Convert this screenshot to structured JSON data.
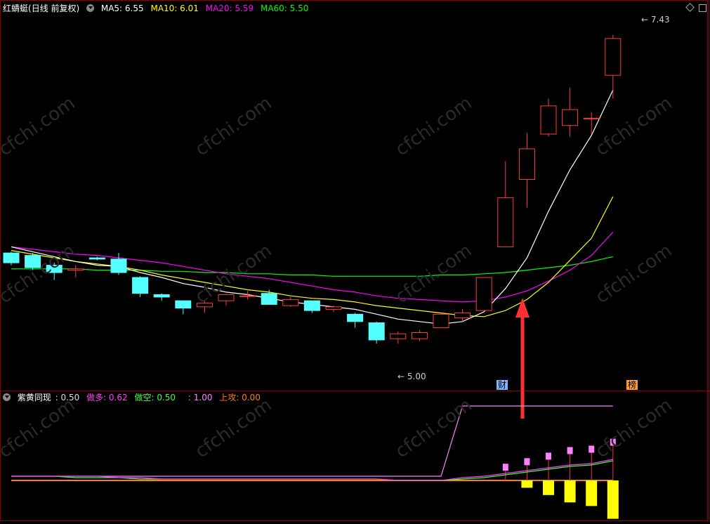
{
  "main": {
    "stock_name": "红蜻蜓",
    "period": "(日线 前复权)",
    "ma": [
      {
        "label": "MA5: 6.55",
        "color": "#ffffff"
      },
      {
        "label": "MA10: 6.01",
        "color": "#ffff00"
      },
      {
        "label": "MA20: 5.59",
        "color": "#ff00ff"
      },
      {
        "label": "MA60: 5.50",
        "color": "#00ff00"
      }
    ],
    "high_label": "7.43",
    "low_label": "5.00",
    "tag_cai": "财",
    "tag_bang": "榜"
  },
  "sub": {
    "name": "紫黄同现",
    "items": [
      {
        "label": ": 0.50",
        "color": "#dddddd"
      },
      {
        "label": "做多: 0.62",
        "color": "#ff40ff"
      },
      {
        "label": "做空: 0.50",
        "color": "#40ff40"
      },
      {
        "label": ": 1.00",
        "color": "#ff80ff"
      },
      {
        "label": "上攻: 0.00",
        "color": "#ff8000"
      }
    ]
  },
  "watermark": "cfchi.com",
  "colors": {
    "up": "#ff3c3c",
    "down": "#54ffff",
    "grid": "#8b0000"
  },
  "chart_data": {
    "type": "candlestick",
    "candles": [
      {
        "o": 6.0,
        "h": 6.01,
        "l": 5.9,
        "c": 5.92
      },
      {
        "o": 5.98,
        "h": 6.0,
        "l": 5.86,
        "c": 5.88
      },
      {
        "o": 5.9,
        "h": 5.92,
        "l": 5.78,
        "c": 5.84
      },
      {
        "o": 5.86,
        "h": 5.9,
        "l": 5.8,
        "c": 5.87
      },
      {
        "o": 5.96,
        "h": 5.97,
        "l": 5.94,
        "c": 5.95
      },
      {
        "o": 5.95,
        "h": 6.0,
        "l": 5.82,
        "c": 5.84
      },
      {
        "o": 5.8,
        "h": 5.81,
        "l": 5.64,
        "c": 5.67
      },
      {
        "o": 5.66,
        "h": 5.67,
        "l": 5.61,
        "c": 5.64
      },
      {
        "o": 5.61,
        "h": 5.61,
        "l": 5.5,
        "c": 5.55
      },
      {
        "o": 5.56,
        "h": 5.61,
        "l": 5.51,
        "c": 5.59
      },
      {
        "o": 5.61,
        "h": 5.66,
        "l": 5.57,
        "c": 5.66
      },
      {
        "o": 5.65,
        "h": 5.69,
        "l": 5.62,
        "c": 5.65
      },
      {
        "o": 5.67,
        "h": 5.7,
        "l": 5.58,
        "c": 5.58
      },
      {
        "o": 5.57,
        "h": 5.64,
        "l": 5.56,
        "c": 5.62
      },
      {
        "o": 5.61,
        "h": 5.61,
        "l": 5.51,
        "c": 5.53
      },
      {
        "o": 5.54,
        "h": 5.57,
        "l": 5.52,
        "c": 5.56
      },
      {
        "o": 5.5,
        "h": 5.51,
        "l": 5.39,
        "c": 5.44
      },
      {
        "o": 5.43,
        "h": 5.44,
        "l": 5.26,
        "c": 5.29
      },
      {
        "o": 5.3,
        "h": 5.36,
        "l": 5.26,
        "c": 5.34
      },
      {
        "o": 5.3,
        "h": 5.37,
        "l": 5.28,
        "c": 5.35
      },
      {
        "o": 5.39,
        "h": 5.51,
        "l": 5.39,
        "c": 5.5
      },
      {
        "o": 5.47,
        "h": 5.54,
        "l": 5.44,
        "c": 5.51
      },
      {
        "o": 5.53,
        "h": 5.8,
        "l": 5.53,
        "c": 5.8
      },
      {
        "o": 6.05,
        "h": 6.75,
        "l": 6.05,
        "c": 6.45
      },
      {
        "o": 6.6,
        "h": 6.98,
        "l": 6.37,
        "c": 6.85
      },
      {
        "o": 6.97,
        "h": 7.26,
        "l": 6.95,
        "c": 7.2
      },
      {
        "o": 7.04,
        "h": 7.35,
        "l": 6.95,
        "c": 7.17
      },
      {
        "o": 7.1,
        "h": 7.15,
        "l": 6.97,
        "c": 7.1
      },
      {
        "o": 7.45,
        "h": 7.78,
        "l": 7.26,
        "c": 7.75
      }
    ],
    "ma5": [
      6.05,
      6.01,
      5.97,
      5.93,
      5.9,
      5.89,
      5.84,
      5.8,
      5.75,
      5.72,
      5.68,
      5.66,
      5.63,
      5.6,
      5.58,
      5.56,
      5.54,
      5.5,
      5.46,
      5.44,
      5.42,
      5.44,
      5.52,
      5.71,
      5.96,
      6.34,
      6.68,
      6.96,
      7.33
    ],
    "ma10": [
      6.02,
      5.99,
      5.96,
      5.93,
      5.91,
      5.89,
      5.86,
      5.82,
      5.79,
      5.76,
      5.73,
      5.7,
      5.68,
      5.65,
      5.63,
      5.62,
      5.6,
      5.57,
      5.55,
      5.53,
      5.51,
      5.49,
      5.48,
      5.53,
      5.62,
      5.76,
      5.94,
      6.12,
      6.46
    ],
    "ma20": [
      6.05,
      6.03,
      6.01,
      5.99,
      5.98,
      5.96,
      5.94,
      5.92,
      5.89,
      5.86,
      5.83,
      5.81,
      5.79,
      5.76,
      5.73,
      5.7,
      5.68,
      5.65,
      5.63,
      5.62,
      5.61,
      5.6,
      5.61,
      5.64,
      5.69,
      5.77,
      5.86,
      5.98,
      6.17
    ],
    "ma60": [
      5.87,
      5.87,
      5.87,
      5.87,
      5.86,
      5.86,
      5.86,
      5.85,
      5.85,
      5.84,
      5.84,
      5.83,
      5.83,
      5.82,
      5.82,
      5.81,
      5.81,
      5.81,
      5.81,
      5.81,
      5.82,
      5.82,
      5.83,
      5.84,
      5.86,
      5.88,
      5.9,
      5.93,
      5.97
    ],
    "sub": {
      "zuoduo": [
        0.5,
        0.5,
        0.5,
        0.5,
        0.5,
        0.49,
        0.49,
        0.48,
        0.48,
        0.48,
        0.48,
        0.48,
        0.48,
        0.48,
        0.48,
        0.48,
        0.48,
        0.48,
        0.47,
        0.47,
        0.47,
        0.49,
        0.5,
        0.52,
        0.54,
        0.56,
        0.58,
        0.59,
        0.62
      ],
      "zuokong": [
        0.5,
        0.5,
        0.5,
        0.49,
        0.49,
        0.49,
        0.48,
        0.48,
        0.48,
        0.48,
        0.48,
        0.48,
        0.48,
        0.48,
        0.48,
        0.48,
        0.48,
        0.48,
        0.47,
        0.47,
        0.47,
        0.48,
        0.49,
        0.51,
        0.53,
        0.55,
        0.57,
        0.58,
        0.61
      ],
      "purple_line": [
        0.5,
        0.5,
        0.5,
        0.5,
        0.5,
        0.5,
        0.5,
        0.5,
        0.5,
        0.5,
        0.5,
        0.5,
        0.5,
        0.5,
        0.5,
        0.5,
        0.5,
        0.5,
        0.5,
        0.5,
        0.5,
        1.0,
        1.0,
        1.0,
        1.0,
        1.0,
        1.0,
        1.0,
        1.0
      ],
      "yellow_bars": [
        0,
        0,
        0,
        0,
        0,
        0,
        0,
        0,
        0,
        0,
        0,
        0,
        0,
        0,
        0,
        0,
        0,
        0,
        0,
        0,
        0,
        0,
        0,
        0.0,
        0.04,
        0.08,
        0.12,
        0.14,
        0.21
      ],
      "pink_bars": [
        0,
        0,
        0,
        0,
        0,
        0,
        0,
        0,
        0,
        0,
        0,
        0,
        0,
        0,
        0,
        0,
        0,
        0,
        0,
        0,
        0,
        0,
        0,
        0.02,
        0.03,
        0.04,
        0.05,
        0.05,
        0.06
      ]
    }
  }
}
